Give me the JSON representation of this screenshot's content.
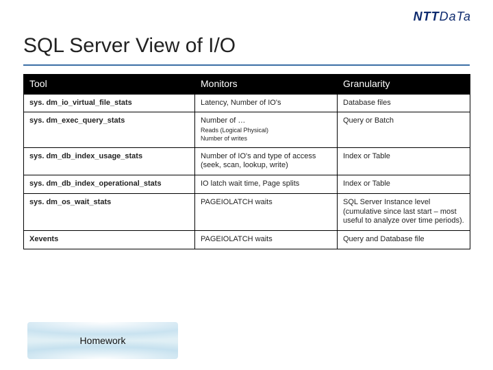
{
  "brand": {
    "name_bold": "NTT",
    "name_light": "DaTa"
  },
  "title": "SQL Server View of I/O",
  "table": {
    "headers": [
      "Tool",
      "Monitors",
      "Granularity"
    ],
    "rows": [
      {
        "tool": "sys. dm_io_virtual_file_stats",
        "monitors_main": "Latency, Number of IO's",
        "monitors_sub1": "",
        "monitors_sub2": "",
        "granularity": "Database files"
      },
      {
        "tool": "sys. dm_exec_query_stats",
        "monitors_main": "Number of …",
        "monitors_sub1": "Reads (Logical Physical)",
        "monitors_sub2": "Number of writes",
        "granularity": "Query or Batch"
      },
      {
        "tool": "sys. dm_db_index_usage_stats",
        "monitors_main": "Number of IO's and type of access (seek, scan, lookup, write)",
        "monitors_sub1": "",
        "monitors_sub2": "",
        "granularity": "Index or Table"
      },
      {
        "tool": "sys. dm_db_index_operational_stats",
        "monitors_main": "IO latch wait time, Page splits",
        "monitors_sub1": "",
        "monitors_sub2": "",
        "granularity": "Index or Table"
      },
      {
        "tool": "sys. dm_os_wait_stats",
        "monitors_main": "PAGEIOLATCH waits",
        "monitors_sub1": "",
        "monitors_sub2": "",
        "granularity": "SQL Server Instance level (cumulative since last start – most useful to analyze over time periods)."
      },
      {
        "tool": "Xevents",
        "monitors_main": "PAGEIOLATCH waits",
        "monitors_sub1": "",
        "monitors_sub2": "",
        "granularity": "Query and Database file"
      }
    ]
  },
  "homework_label": "Homework"
}
